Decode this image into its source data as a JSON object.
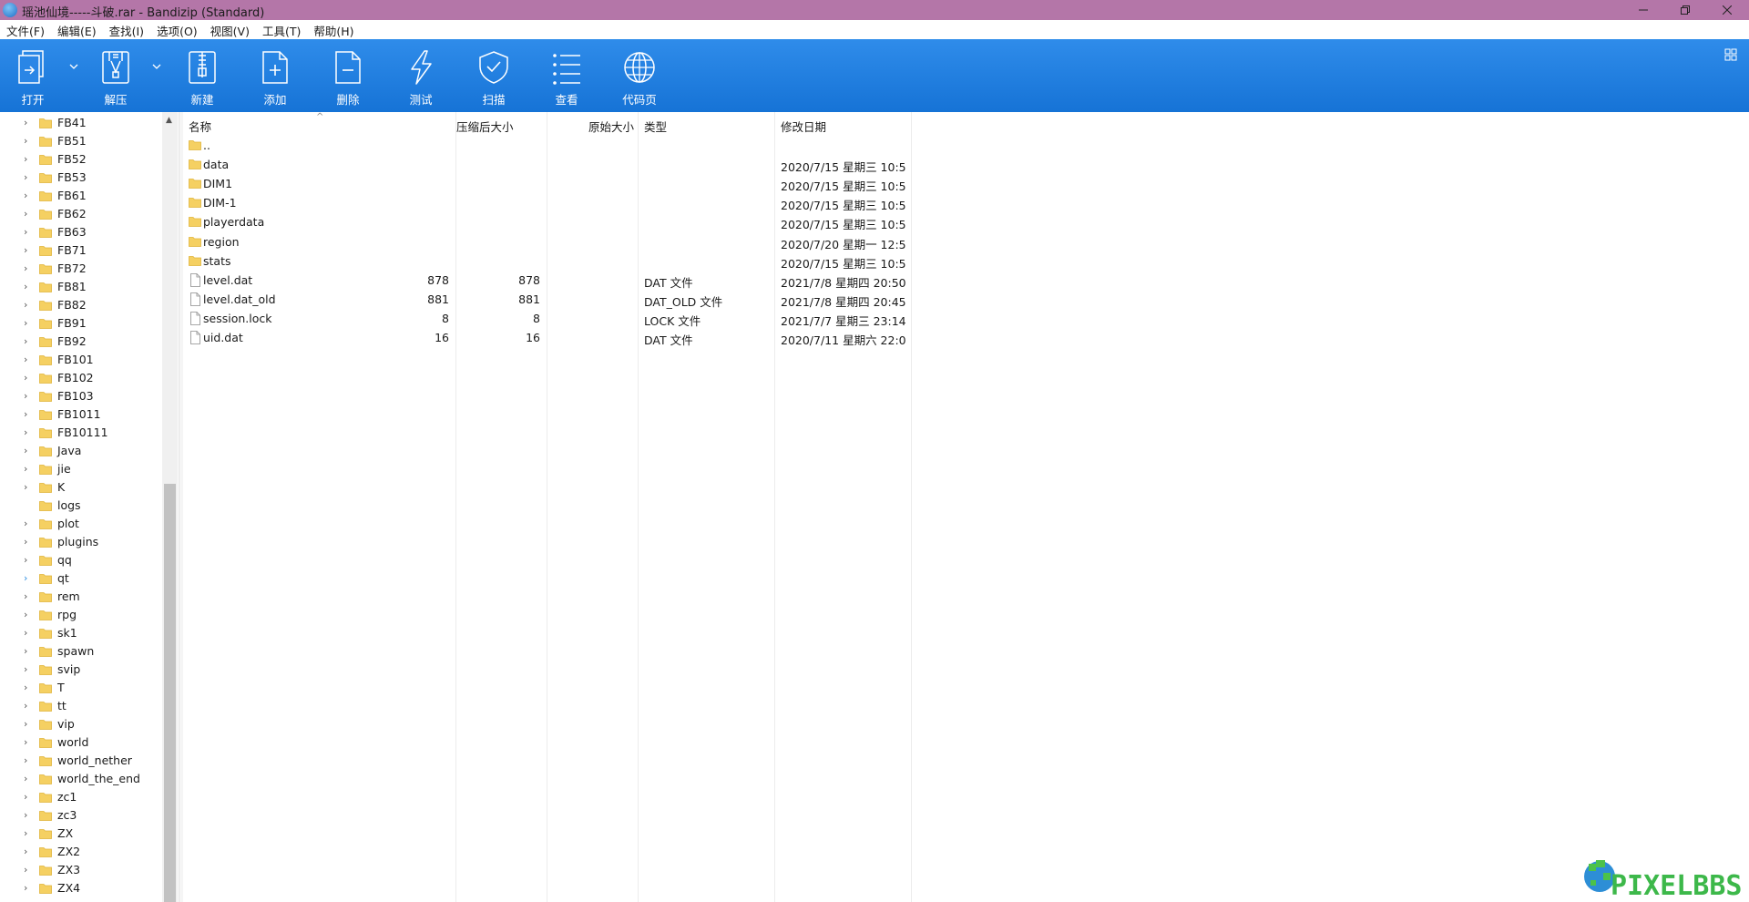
{
  "window": {
    "title": "瑶池仙境-----斗破.rar - Bandizip (Standard)"
  },
  "menu": [
    "文件(F)",
    "编辑(E)",
    "查找(I)",
    "选项(O)",
    "视图(V)",
    "工具(T)",
    "帮助(H)"
  ],
  "toolbar": {
    "open": "打开",
    "extract": "解压",
    "new": "新建",
    "add": "添加",
    "delete": "删除",
    "test": "测试",
    "scan": "扫描",
    "view": "查看",
    "codepage": "代码页"
  },
  "tree": {
    "items": [
      {
        "label": "FB41",
        "expand": true
      },
      {
        "label": "FB51",
        "expand": true
      },
      {
        "label": "FB52",
        "expand": true
      },
      {
        "label": "FB53",
        "expand": true
      },
      {
        "label": "FB61",
        "expand": true
      },
      {
        "label": "FB62",
        "expand": true
      },
      {
        "label": "FB63",
        "expand": true
      },
      {
        "label": "FB71",
        "expand": true
      },
      {
        "label": "FB72",
        "expand": true
      },
      {
        "label": "FB81",
        "expand": true
      },
      {
        "label": "FB82",
        "expand": true
      },
      {
        "label": "FB91",
        "expand": true
      },
      {
        "label": "FB92",
        "expand": true
      },
      {
        "label": "FB101",
        "expand": true
      },
      {
        "label": "FB102",
        "expand": true
      },
      {
        "label": "FB103",
        "expand": true
      },
      {
        "label": "FB1011",
        "expand": true
      },
      {
        "label": "FB10111",
        "expand": true
      },
      {
        "label": "Java",
        "expand": true
      },
      {
        "label": "jie",
        "expand": true
      },
      {
        "label": "K",
        "expand": true
      },
      {
        "label": "logs",
        "expand": false
      },
      {
        "label": "plot",
        "expand": true
      },
      {
        "label": "plugins",
        "expand": true
      },
      {
        "label": "qq",
        "expand": true
      },
      {
        "label": "qt",
        "expand": true,
        "highlight": true
      },
      {
        "label": "rem",
        "expand": true
      },
      {
        "label": "rpg",
        "expand": true
      },
      {
        "label": "sk1",
        "expand": true
      },
      {
        "label": "spawn",
        "expand": true
      },
      {
        "label": "svip",
        "expand": true
      },
      {
        "label": "T",
        "expand": true
      },
      {
        "label": "tt",
        "expand": true
      },
      {
        "label": "vip",
        "expand": true
      },
      {
        "label": "world",
        "expand": true
      },
      {
        "label": "world_nether",
        "expand": true
      },
      {
        "label": "world_the_end",
        "expand": true
      },
      {
        "label": "zc1",
        "expand": true
      },
      {
        "label": "zc3",
        "expand": true
      },
      {
        "label": "ZX",
        "expand": true
      },
      {
        "label": "ZX2",
        "expand": true
      },
      {
        "label": "ZX3",
        "expand": true
      },
      {
        "label": "ZX4",
        "expand": true
      }
    ]
  },
  "columns": {
    "name": "名称",
    "compressed": "压缩后大小",
    "original": "原始大小",
    "type": "类型",
    "modified": "修改日期"
  },
  "files": [
    {
      "name": "..",
      "kind": "folder",
      "compressed": "",
      "original": "",
      "type": "",
      "modified": ""
    },
    {
      "name": "data",
      "kind": "folder",
      "compressed": "",
      "original": "",
      "type": "",
      "modified": "2020/7/15 星期三 10:5..."
    },
    {
      "name": "DIM1",
      "kind": "folder",
      "compressed": "",
      "original": "",
      "type": "",
      "modified": "2020/7/15 星期三 10:5..."
    },
    {
      "name": "DIM-1",
      "kind": "folder",
      "compressed": "",
      "original": "",
      "type": "",
      "modified": "2020/7/15 星期三 10:5..."
    },
    {
      "name": "playerdata",
      "kind": "folder",
      "compressed": "",
      "original": "",
      "type": "",
      "modified": "2020/7/15 星期三 10:5..."
    },
    {
      "name": "region",
      "kind": "folder",
      "compressed": "",
      "original": "",
      "type": "",
      "modified": "2020/7/20 星期一 12:5..."
    },
    {
      "name": "stats",
      "kind": "folder",
      "compressed": "",
      "original": "",
      "type": "",
      "modified": "2020/7/15 星期三 10:5..."
    },
    {
      "name": "level.dat",
      "kind": "file",
      "compressed": "878",
      "original": "878",
      "type": "DAT 文件",
      "modified": "2021/7/8 星期四 20:50..."
    },
    {
      "name": "level.dat_old",
      "kind": "file",
      "compressed": "881",
      "original": "881",
      "type": "DAT_OLD 文件",
      "modified": "2021/7/8 星期四 20:45..."
    },
    {
      "name": "session.lock",
      "kind": "file",
      "compressed": "8",
      "original": "8",
      "type": "LOCK 文件",
      "modified": "2021/7/7 星期三 23:14..."
    },
    {
      "name": "uid.dat",
      "kind": "file",
      "compressed": "16",
      "original": "16",
      "type": "DAT 文件",
      "modified": "2020/7/11 星期六 22:0..."
    }
  ],
  "watermark": "PIXELBBS",
  "colors": {
    "titlebar": "#b476a8",
    "toolbar": "#1f7fe0",
    "folder": "#f5d062"
  }
}
